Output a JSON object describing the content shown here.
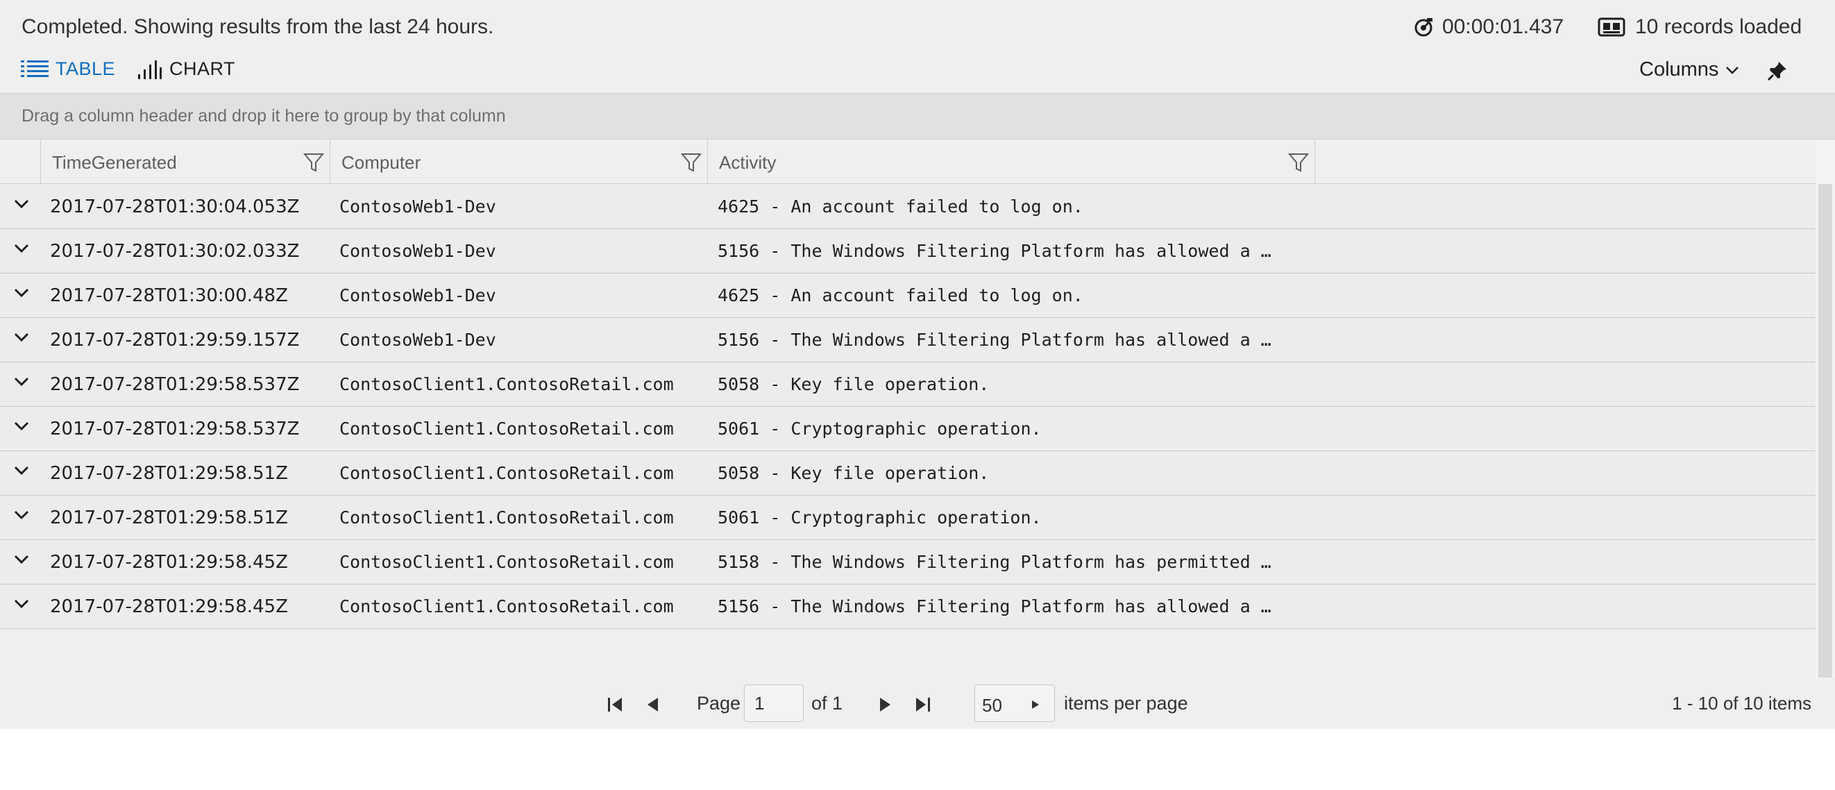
{
  "status": {
    "message": "Completed. Showing results from the last 24 hours.",
    "elapsed": "00:00:01.437",
    "records": "10 records loaded"
  },
  "tabs": {
    "table": "TABLE",
    "chart": "CHART"
  },
  "toolbar": {
    "columns_label": "Columns"
  },
  "group_hint": "Drag a column header and drop it here to group by that column",
  "columns": [
    "TimeGenerated",
    "Computer",
    "Activity"
  ],
  "rows": [
    {
      "time": "2017-07-28T01:30:04.053Z",
      "computer": "ContosoWeb1-Dev",
      "activity": "4625 - An account failed to log on."
    },
    {
      "time": "2017-07-28T01:30:02.033Z",
      "computer": "ContosoWeb1-Dev",
      "activity": "5156 - The Windows Filtering Platform has allowed a …"
    },
    {
      "time": "2017-07-28T01:30:00.48Z",
      "computer": "ContosoWeb1-Dev",
      "activity": "4625 - An account failed to log on."
    },
    {
      "time": "2017-07-28T01:29:59.157Z",
      "computer": "ContosoWeb1-Dev",
      "activity": "5156 - The Windows Filtering Platform has allowed a …"
    },
    {
      "time": "2017-07-28T01:29:58.537Z",
      "computer": "ContosoClient1.ContosoRetail.com",
      "activity": "5058 - Key file operation."
    },
    {
      "time": "2017-07-28T01:29:58.537Z",
      "computer": "ContosoClient1.ContosoRetail.com",
      "activity": "5061 - Cryptographic operation."
    },
    {
      "time": "2017-07-28T01:29:58.51Z",
      "computer": "ContosoClient1.ContosoRetail.com",
      "activity": "5058 - Key file operation."
    },
    {
      "time": "2017-07-28T01:29:58.51Z",
      "computer": "ContosoClient1.ContosoRetail.com",
      "activity": "5061 - Cryptographic operation."
    },
    {
      "time": "2017-07-28T01:29:58.45Z",
      "computer": "ContosoClient1.ContosoRetail.com",
      "activity": "5158 - The Windows Filtering Platform has permitted …"
    },
    {
      "time": "2017-07-28T01:29:58.45Z",
      "computer": "ContosoClient1.ContosoRetail.com",
      "activity": "5156 - The Windows Filtering Platform has allowed a …"
    }
  ],
  "pager": {
    "page_label": "Page",
    "page_value": "1",
    "of_label": "of 1",
    "per_page_value": "50",
    "per_page_label": "items per page",
    "summary": "1 - 10 of 10 items"
  },
  "colors": {
    "accent": "#106ebe",
    "panel": "#efefef",
    "group_bar": "#e1e1e1"
  },
  "icons": [
    "timer-icon",
    "records-icon",
    "table-icon",
    "chart-icon",
    "chevron-down-icon",
    "pin-icon",
    "filter-icon",
    "first-page-icon",
    "prev-page-icon",
    "next-page-icon",
    "last-page-icon"
  ]
}
